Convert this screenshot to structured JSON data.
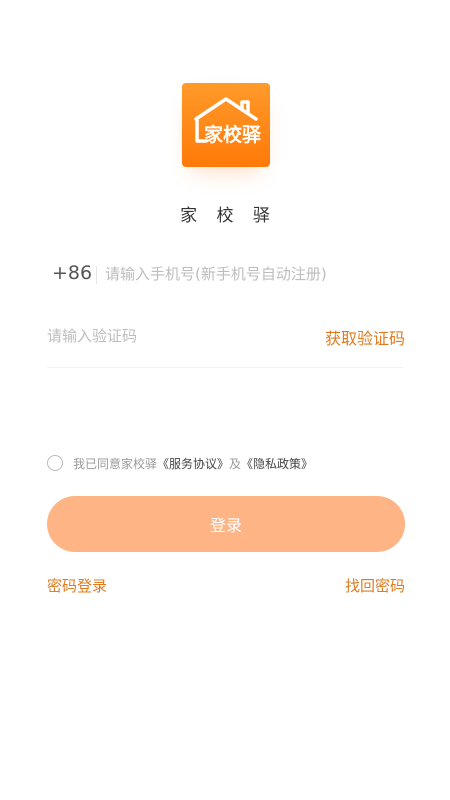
{
  "app": {
    "logo_text": "家校驿",
    "name": "家 校 驿"
  },
  "login_form": {
    "country_code": "+86",
    "phone_placeholder": "请输入手机号(新手机号自动注册)",
    "phone_value": "",
    "code_placeholder": "请输入验证码",
    "code_value": "",
    "get_code_label": "获取验证码"
  },
  "agreement": {
    "checked": false,
    "prefix": "我已同意家校驿",
    "service_link": "《服务协议》",
    "connector": "及",
    "privacy_link": "《隐私政策》"
  },
  "actions": {
    "login_label": "登录",
    "password_login_label": "密码登录",
    "forgot_password_label": "找回密码"
  },
  "colors": {
    "brand_orange": "#ff7a08",
    "link_orange": "#e07b1f",
    "button_disabled": "#ffb485"
  },
  "icons": {
    "logo": "house-roof-logo-icon",
    "checkbox": "radio-circle-icon"
  }
}
